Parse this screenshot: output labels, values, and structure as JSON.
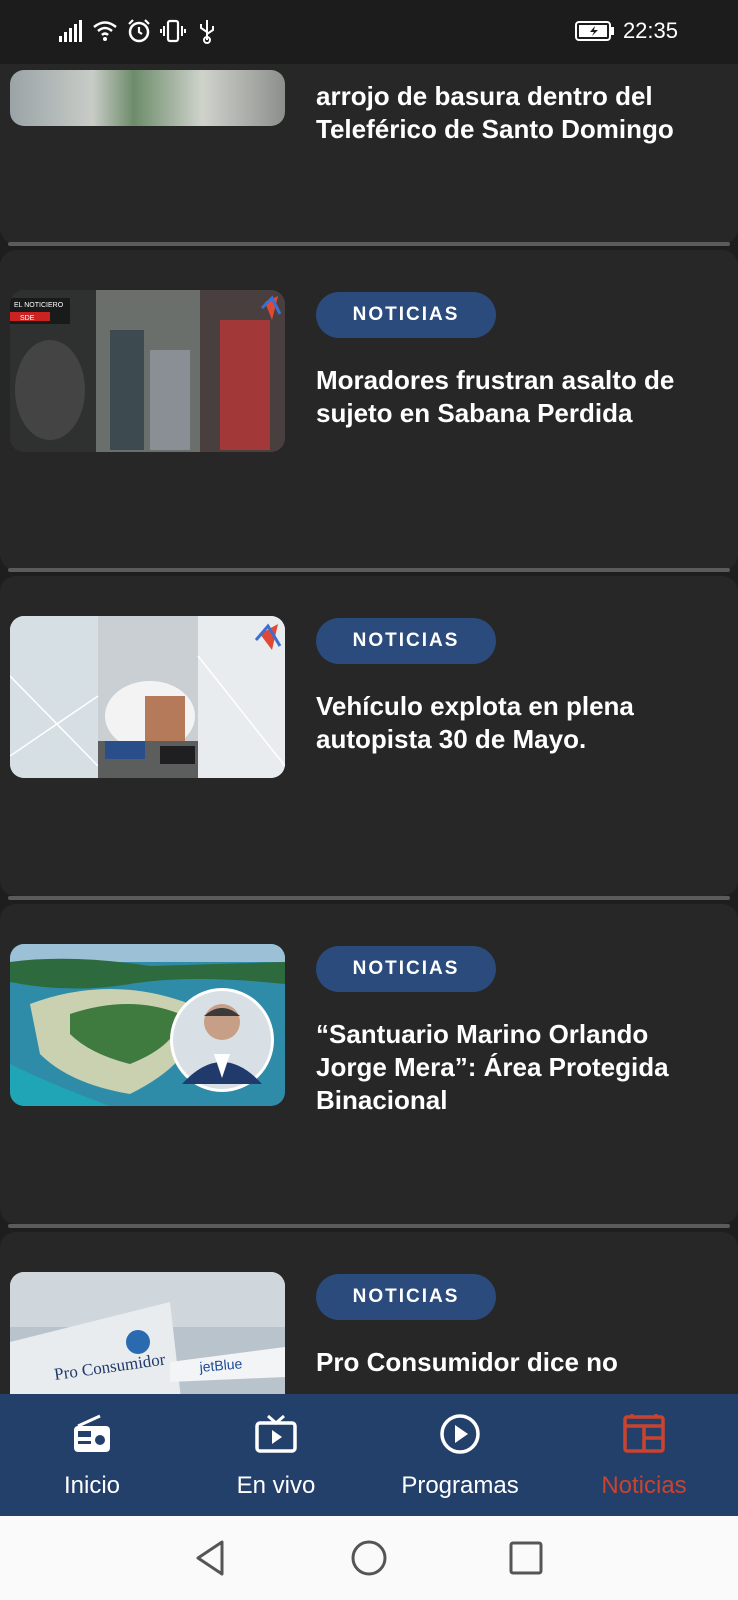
{
  "status_bar": {
    "time": "22:35",
    "icons": [
      "signal-icon",
      "wifi-icon",
      "alarm-icon",
      "vibrate-icon",
      "usb-icon",
      "battery-charging-icon"
    ]
  },
  "articles": [
    {
      "tag": "",
      "title": "arrojo de basura dentro del Teleférico de Santo Domingo"
    },
    {
      "tag": "NOTICIAS",
      "title": "Moradores frustran asalto de sujeto en Sabana Perdida",
      "thumb_text": [
        "EL NOTICIERO",
        "SDE"
      ]
    },
    {
      "tag": "NOTICIAS",
      "title": "Vehículo explota en plena autopista 30 de Mayo."
    },
    {
      "tag": "NOTICIAS",
      "title": "“Santuario Marino Orlando Jorge Mera”: Área Protegida Binacional"
    },
    {
      "tag": "NOTICIAS",
      "title": "Pro Consumidor dice no",
      "thumb_text": [
        "Pro Consumidor",
        "jetBlue"
      ]
    }
  ],
  "bottom_nav": {
    "items": [
      {
        "label": "Inicio",
        "icon": "radio-icon"
      },
      {
        "label": "En vivo",
        "icon": "tv-icon"
      },
      {
        "label": "Programas",
        "icon": "play-circle-icon"
      },
      {
        "label": "Noticias",
        "icon": "news-icon"
      }
    ],
    "active": "Noticias",
    "active_color": "#c9432f",
    "background_color": "#23406b"
  },
  "system_nav": [
    "back-icon",
    "home-icon",
    "recents-icon"
  ],
  "colors": {
    "tag_bg": "#2a4b7c",
    "card_bg": "#272727"
  }
}
